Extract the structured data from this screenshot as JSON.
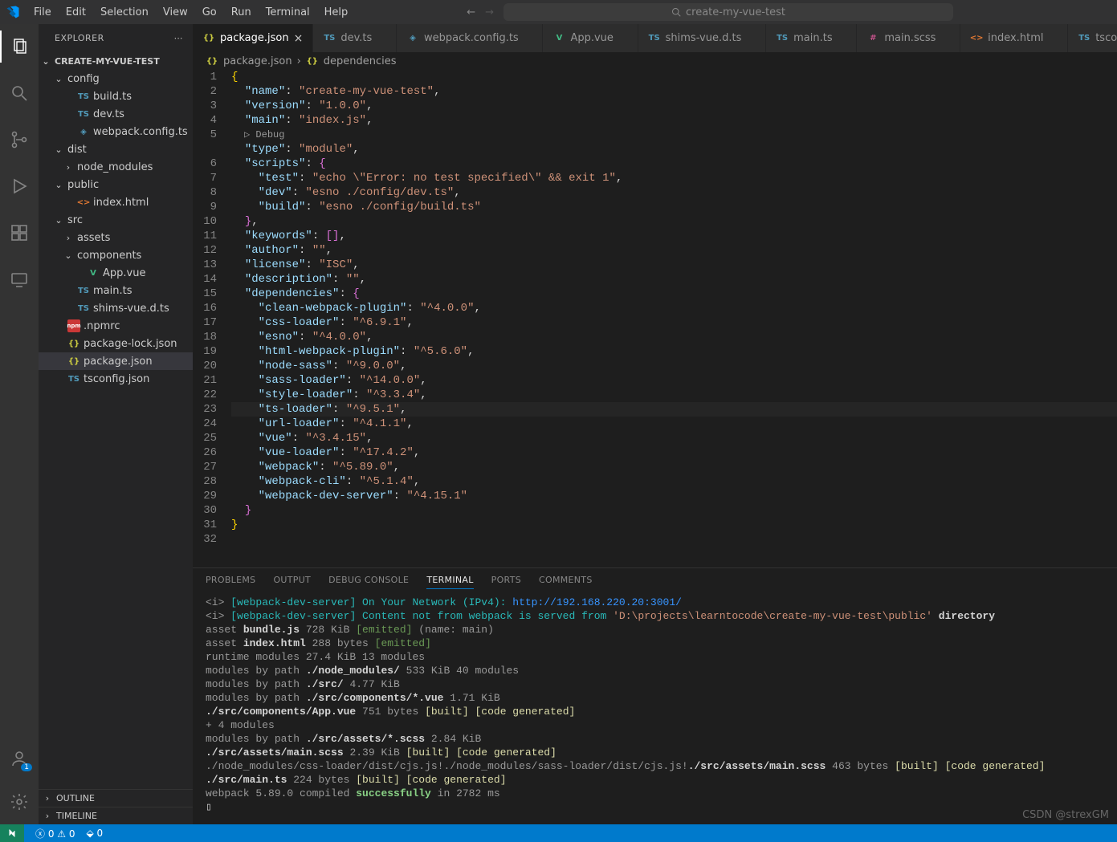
{
  "menu": [
    "File",
    "Edit",
    "Selection",
    "View",
    "Go",
    "Run",
    "Terminal",
    "Help"
  ],
  "search_placeholder": "create-my-vue-test",
  "sidebar_title": "EXPLORER",
  "project_name": "CREATE-MY-VUE-TEST",
  "tree": [
    {
      "d": 1,
      "t": "folder",
      "open": true,
      "label": "config"
    },
    {
      "d": 2,
      "t": "ts",
      "label": "build.ts"
    },
    {
      "d": 2,
      "t": "ts",
      "label": "dev.ts"
    },
    {
      "d": 2,
      "t": "webpack",
      "label": "webpack.config.ts"
    },
    {
      "d": 1,
      "t": "folder",
      "open": true,
      "label": "dist"
    },
    {
      "d": 2,
      "t": "folder",
      "open": false,
      "label": "node_modules"
    },
    {
      "d": 1,
      "t": "folder",
      "open": true,
      "label": "public"
    },
    {
      "d": 2,
      "t": "html",
      "label": "index.html"
    },
    {
      "d": 1,
      "t": "folder",
      "open": true,
      "label": "src"
    },
    {
      "d": 2,
      "t": "folder",
      "open": false,
      "label": "assets"
    },
    {
      "d": 2,
      "t": "folder",
      "open": true,
      "label": "components"
    },
    {
      "d": 3,
      "t": "vue",
      "label": "App.vue"
    },
    {
      "d": 2,
      "t": "ts",
      "label": "main.ts"
    },
    {
      "d": 2,
      "t": "ts",
      "label": "shims-vue.d.ts"
    },
    {
      "d": 1,
      "t": "npm",
      "label": ".npmrc"
    },
    {
      "d": 1,
      "t": "json",
      "label": "package-lock.json"
    },
    {
      "d": 1,
      "t": "json",
      "label": "package.json",
      "sel": true
    },
    {
      "d": 1,
      "t": "tsconf",
      "label": "tsconfig.json"
    }
  ],
  "outline_label": "OUTLINE",
  "timeline_label": "TIMELINE",
  "tabs": [
    {
      "icon": "json",
      "label": "package.json",
      "active": true
    },
    {
      "icon": "ts",
      "label": "dev.ts"
    },
    {
      "icon": "webpack",
      "label": "webpack.config.ts"
    },
    {
      "icon": "vue",
      "label": "App.vue"
    },
    {
      "icon": "ts",
      "label": "shims-vue.d.ts"
    },
    {
      "icon": "ts",
      "label": "main.ts"
    },
    {
      "icon": "scss",
      "label": "main.scss"
    },
    {
      "icon": "html",
      "label": "index.html"
    },
    {
      "icon": "tsconf",
      "label": "tsconfig.jso"
    }
  ],
  "breadcrumb": [
    "package.json",
    "dependencies"
  ],
  "codelens": "Debug",
  "code": [
    {
      "n": 1,
      "t": [
        [
          "brace",
          "{"
        ]
      ]
    },
    {
      "n": 2,
      "t": [
        [
          "pun",
          "  "
        ],
        [
          "key",
          "\"name\""
        ],
        [
          "pun",
          ": "
        ],
        [
          "str",
          "\"create-my-vue-test\""
        ],
        [
          "pun",
          ","
        ]
      ]
    },
    {
      "n": 3,
      "t": [
        [
          "pun",
          "  "
        ],
        [
          "key",
          "\"version\""
        ],
        [
          "pun",
          ": "
        ],
        [
          "str",
          "\"1.0.0\""
        ],
        [
          "pun",
          ","
        ]
      ]
    },
    {
      "n": 4,
      "t": [
        [
          "pun",
          "  "
        ],
        [
          "key",
          "\"main\""
        ],
        [
          "pun",
          ": "
        ],
        [
          "str",
          "\"index.js\""
        ],
        [
          "pun",
          ","
        ]
      ]
    },
    {
      "n": 5,
      "t": [
        [
          "pun",
          "  "
        ],
        [
          "key",
          "\"type\""
        ],
        [
          "pun",
          ": "
        ],
        [
          "str",
          "\"module\""
        ],
        [
          "pun",
          ","
        ]
      ],
      "lens": true
    },
    {
      "n": 6,
      "t": [
        [
          "pun",
          "  "
        ],
        [
          "key",
          "\"scripts\""
        ],
        [
          "pun",
          ": "
        ],
        [
          "brace2",
          "{"
        ]
      ]
    },
    {
      "n": 7,
      "t": [
        [
          "pun",
          "    "
        ],
        [
          "key",
          "\"test\""
        ],
        [
          "pun",
          ": "
        ],
        [
          "str",
          "\"echo \\\"Error: no test specified\\\" && exit 1\""
        ],
        [
          "pun",
          ","
        ]
      ]
    },
    {
      "n": 8,
      "t": [
        [
          "pun",
          "    "
        ],
        [
          "key",
          "\"dev\""
        ],
        [
          "pun",
          ": "
        ],
        [
          "str",
          "\"esno ./config/dev.ts\""
        ],
        [
          "pun",
          ","
        ]
      ]
    },
    {
      "n": 9,
      "t": [
        [
          "pun",
          "    "
        ],
        [
          "key",
          "\"build\""
        ],
        [
          "pun",
          ": "
        ],
        [
          "str",
          "\"esno ./config/build.ts\""
        ]
      ]
    },
    {
      "n": 10,
      "t": [
        [
          "pun",
          "  "
        ],
        [
          "brace2",
          "}"
        ],
        [
          "pun",
          ","
        ]
      ]
    },
    {
      "n": 11,
      "t": [
        [
          "pun",
          "  "
        ],
        [
          "key",
          "\"keywords\""
        ],
        [
          "pun",
          ": "
        ],
        [
          "brace2",
          "["
        ],
        [
          "brace2",
          "]"
        ],
        [
          "pun",
          ","
        ]
      ]
    },
    {
      "n": 12,
      "t": [
        [
          "pun",
          "  "
        ],
        [
          "key",
          "\"author\""
        ],
        [
          "pun",
          ": "
        ],
        [
          "str",
          "\"\""
        ],
        [
          "pun",
          ","
        ]
      ]
    },
    {
      "n": 13,
      "t": [
        [
          "pun",
          "  "
        ],
        [
          "key",
          "\"license\""
        ],
        [
          "pun",
          ": "
        ],
        [
          "str",
          "\"ISC\""
        ],
        [
          "pun",
          ","
        ]
      ]
    },
    {
      "n": 14,
      "t": [
        [
          "pun",
          "  "
        ],
        [
          "key",
          "\"description\""
        ],
        [
          "pun",
          ": "
        ],
        [
          "str",
          "\"\""
        ],
        [
          "pun",
          ","
        ]
      ]
    },
    {
      "n": 15,
      "t": [
        [
          "pun",
          "  "
        ],
        [
          "key",
          "\"dependencies\""
        ],
        [
          "pun",
          ": "
        ],
        [
          "brace2",
          "{"
        ]
      ]
    },
    {
      "n": 16,
      "t": [
        [
          "pun",
          "    "
        ],
        [
          "key",
          "\"clean-webpack-plugin\""
        ],
        [
          "pun",
          ": "
        ],
        [
          "str",
          "\"^4.0.0\""
        ],
        [
          "pun",
          ","
        ]
      ]
    },
    {
      "n": 17,
      "t": [
        [
          "pun",
          "    "
        ],
        [
          "key",
          "\"css-loader\""
        ],
        [
          "pun",
          ": "
        ],
        [
          "str",
          "\"^6.9.1\""
        ],
        [
          "pun",
          ","
        ]
      ]
    },
    {
      "n": 18,
      "t": [
        [
          "pun",
          "    "
        ],
        [
          "key",
          "\"esno\""
        ],
        [
          "pun",
          ": "
        ],
        [
          "str",
          "\"^4.0.0\""
        ],
        [
          "pun",
          ","
        ]
      ]
    },
    {
      "n": 19,
      "t": [
        [
          "pun",
          "    "
        ],
        [
          "key",
          "\"html-webpack-plugin\""
        ],
        [
          "pun",
          ": "
        ],
        [
          "str",
          "\"^5.6.0\""
        ],
        [
          "pun",
          ","
        ]
      ]
    },
    {
      "n": 20,
      "t": [
        [
          "pun",
          "    "
        ],
        [
          "key",
          "\"node-sass\""
        ],
        [
          "pun",
          ": "
        ],
        [
          "str",
          "\"^9.0.0\""
        ],
        [
          "pun",
          ","
        ]
      ]
    },
    {
      "n": 21,
      "t": [
        [
          "pun",
          "    "
        ],
        [
          "key",
          "\"sass-loader\""
        ],
        [
          "pun",
          ": "
        ],
        [
          "str",
          "\"^14.0.0\""
        ],
        [
          "pun",
          ","
        ]
      ]
    },
    {
      "n": 22,
      "t": [
        [
          "pun",
          "    "
        ],
        [
          "key",
          "\"style-loader\""
        ],
        [
          "pun",
          ": "
        ],
        [
          "str",
          "\"^3.3.4\""
        ],
        [
          "pun",
          ","
        ]
      ]
    },
    {
      "n": 23,
      "t": [
        [
          "pun",
          "    "
        ],
        [
          "key",
          "\"ts-loader\""
        ],
        [
          "pun",
          ": "
        ],
        [
          "str",
          "\"^9.5.1\""
        ],
        [
          "pun",
          ","
        ]
      ],
      "hl": true
    },
    {
      "n": 24,
      "t": [
        [
          "pun",
          "    "
        ],
        [
          "key",
          "\"url-loader\""
        ],
        [
          "pun",
          ": "
        ],
        [
          "str",
          "\"^4.1.1\""
        ],
        [
          "pun",
          ","
        ]
      ]
    },
    {
      "n": 25,
      "t": [
        [
          "pun",
          "    "
        ],
        [
          "key",
          "\"vue\""
        ],
        [
          "pun",
          ": "
        ],
        [
          "str",
          "\"^3.4.15\""
        ],
        [
          "pun",
          ","
        ]
      ]
    },
    {
      "n": 26,
      "t": [
        [
          "pun",
          "    "
        ],
        [
          "key",
          "\"vue-loader\""
        ],
        [
          "pun",
          ": "
        ],
        [
          "str",
          "\"^17.4.2\""
        ],
        [
          "pun",
          ","
        ]
      ]
    },
    {
      "n": 27,
      "t": [
        [
          "pun",
          "    "
        ],
        [
          "key",
          "\"webpack\""
        ],
        [
          "pun",
          ": "
        ],
        [
          "str",
          "\"^5.89.0\""
        ],
        [
          "pun",
          ","
        ]
      ]
    },
    {
      "n": 28,
      "t": [
        [
          "pun",
          "    "
        ],
        [
          "key",
          "\"webpack-cli\""
        ],
        [
          "pun",
          ": "
        ],
        [
          "str",
          "\"^5.1.4\""
        ],
        [
          "pun",
          ","
        ]
      ]
    },
    {
      "n": 29,
      "t": [
        [
          "pun",
          "    "
        ],
        [
          "key",
          "\"webpack-dev-server\""
        ],
        [
          "pun",
          ": "
        ],
        [
          "str",
          "\"^4.15.1\""
        ]
      ]
    },
    {
      "n": 30,
      "t": [
        [
          "pun",
          "  "
        ],
        [
          "brace2",
          "}"
        ]
      ]
    },
    {
      "n": 31,
      "t": [
        [
          "brace",
          "}"
        ]
      ]
    },
    {
      "n": 32,
      "t": [
        [
          "pun",
          ""
        ]
      ]
    }
  ],
  "panel_tabs": [
    "PROBLEMS",
    "OUTPUT",
    "DEBUG CONSOLE",
    "TERMINAL",
    "PORTS",
    "COMMENTS"
  ],
  "panel_active": 3,
  "terminal": [
    [
      [
        "dim",
        "<i> "
      ],
      [
        "cyan",
        "[webpack-dev-server] On Your Network (IPv4): "
      ],
      [
        "blue",
        "http://192.168.220.20:3001/"
      ]
    ],
    [
      [
        "dim",
        "<i> "
      ],
      [
        "cyan",
        "[webpack-dev-server] Content not from webpack is served from "
      ],
      [
        "orange",
        "'D:\\projects\\learntocode\\create-my-vue-test\\public'"
      ],
      [
        "white",
        " directory"
      ]
    ],
    [
      [
        "dim",
        "asset "
      ],
      [
        "white",
        "bundle.js"
      ],
      [
        "dim",
        " 728 KiB "
      ],
      [
        "greenlt",
        "[emitted]"
      ],
      [
        "dim",
        " (name: main)"
      ]
    ],
    [
      [
        "dim",
        "asset "
      ],
      [
        "white",
        "index.html"
      ],
      [
        "dim",
        " 288 bytes "
      ],
      [
        "greenlt",
        "[emitted]"
      ]
    ],
    [
      [
        "dim",
        "runtime modules 27.4 KiB 13 modules"
      ]
    ],
    [
      [
        "dim",
        "modules by path "
      ],
      [
        "white",
        "./node_modules/"
      ],
      [
        "dim",
        " 533 KiB 40 modules"
      ]
    ],
    [
      [
        "dim",
        "modules by path "
      ],
      [
        "white",
        "./src/"
      ],
      [
        "dim",
        " 4.77 KiB"
      ]
    ],
    [
      [
        "dim",
        "  modules by path "
      ],
      [
        "white",
        "./src/components/*.vue"
      ],
      [
        "dim",
        " 1.71 KiB"
      ]
    ],
    [
      [
        "dim",
        "    "
      ],
      [
        "white",
        "./src/components/App.vue"
      ],
      [
        "dim",
        " 751 bytes "
      ],
      [
        "yellow",
        "[built]"
      ],
      [
        "dim",
        " "
      ],
      [
        "yellow",
        "[code generated]"
      ]
    ],
    [
      [
        "dim",
        "    + 4 modules"
      ]
    ],
    [
      [
        "dim",
        "  modules by path "
      ],
      [
        "white",
        "./src/assets/*.scss"
      ],
      [
        "dim",
        " 2.84 KiB"
      ]
    ],
    [
      [
        "dim",
        "    "
      ],
      [
        "white",
        "./src/assets/main.scss"
      ],
      [
        "dim",
        " 2.39 KiB "
      ],
      [
        "yellow",
        "[built]"
      ],
      [
        "dim",
        " "
      ],
      [
        "yellow",
        "[code generated]"
      ]
    ],
    [
      [
        "dim",
        "    ./node_modules/css-loader/dist/cjs.js!./node_modules/sass-loader/dist/cjs.js!"
      ],
      [
        "white",
        "./src/assets/main.scss"
      ],
      [
        "dim",
        " 463 bytes "
      ],
      [
        "yellow",
        "[built]"
      ],
      [
        "dim",
        " "
      ],
      [
        "yellow",
        "[code generated]"
      ]
    ],
    [
      [
        "dim",
        "  "
      ],
      [
        "white",
        "./src/main.ts"
      ],
      [
        "dim",
        " 224 bytes "
      ],
      [
        "yellow",
        "[built]"
      ],
      [
        "dim",
        " "
      ],
      [
        "yellow",
        "[code generated]"
      ]
    ],
    [
      [
        "dim",
        "webpack 5.89.0 compiled "
      ],
      [
        "green",
        "successfully"
      ],
      [
        "dim",
        " in 2782 ms"
      ]
    ]
  ],
  "status": {
    "errors": "0",
    "warnings": "0",
    "port": "0"
  },
  "watermark": "CSDN @strexGM"
}
